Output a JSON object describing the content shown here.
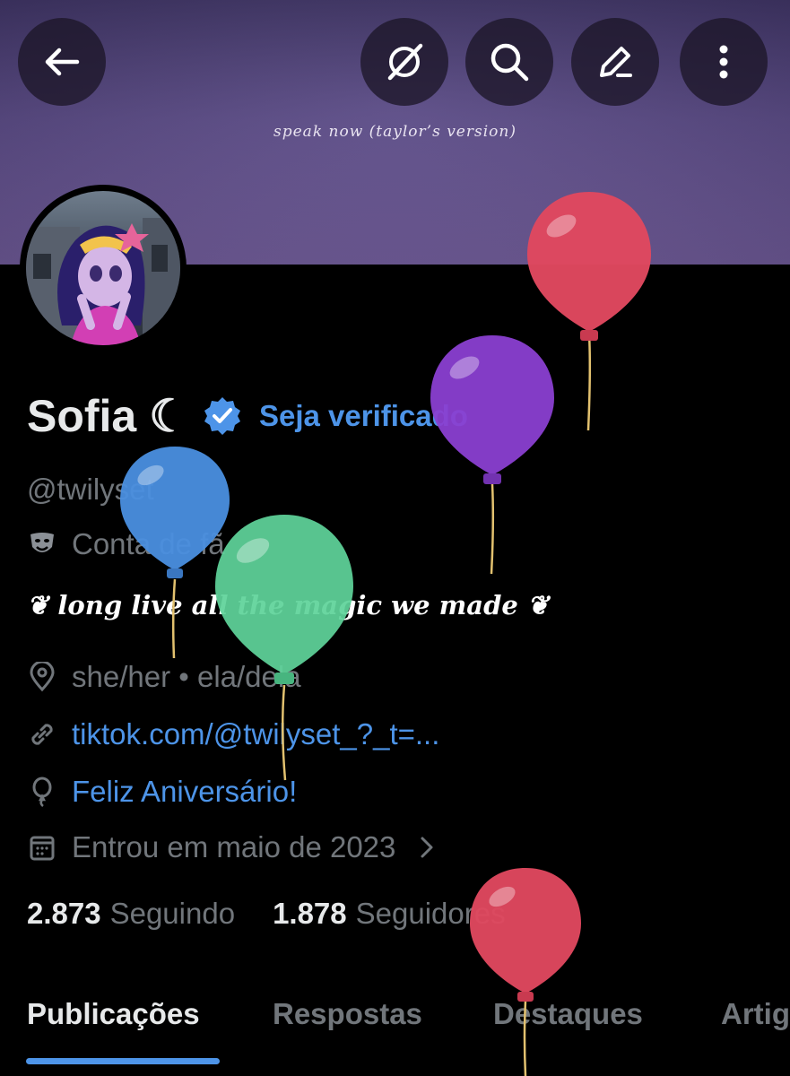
{
  "header": {
    "banner_text": "speak now (taylor’s version)",
    "buttons": [
      {
        "icon": "back-arrow-icon"
      },
      {
        "icon": "grok-icon"
      },
      {
        "icon": "search-icon"
      },
      {
        "icon": "edit-icon"
      },
      {
        "icon": "more-vertical-icon"
      }
    ]
  },
  "profile": {
    "name": "Sofia ☾",
    "verified_badge_icon": "verified-badge-icon",
    "verify_link": "Seja verificado",
    "handle": "@twilyset",
    "category": "Conta de fã",
    "category_icon": "theater-masks-icon",
    "bio": "❦ long live all the magic we made ❦",
    "location": "she/her • ela/dela",
    "location_icon": "location-pin-icon",
    "website": "tiktok.com/@twilyset_?_t=...",
    "website_icon": "link-icon",
    "birthday": "Feliz Aniversário!",
    "birthday_icon": "balloon-icon",
    "joined": "Entrou em maio de 2023",
    "joined_icon": "calendar-icon",
    "following_count": "2.873",
    "following_label": "Seguindo",
    "followers_count": "1.878",
    "followers_label": "Seguidores"
  },
  "tabs": [
    {
      "label": "Publicações",
      "active": true
    },
    {
      "label": "Respostas",
      "active": false
    },
    {
      "label": "Destaques",
      "active": false
    },
    {
      "label": "Artig",
      "active": false
    }
  ],
  "colors": {
    "accent": "#4d94e8",
    "muted_text": "#71767b",
    "balloon_red": "#e0485f",
    "balloon_purple": "#8a3fd1",
    "balloon_blue": "#4a8fe0",
    "balloon_green": "#5fd39a"
  }
}
